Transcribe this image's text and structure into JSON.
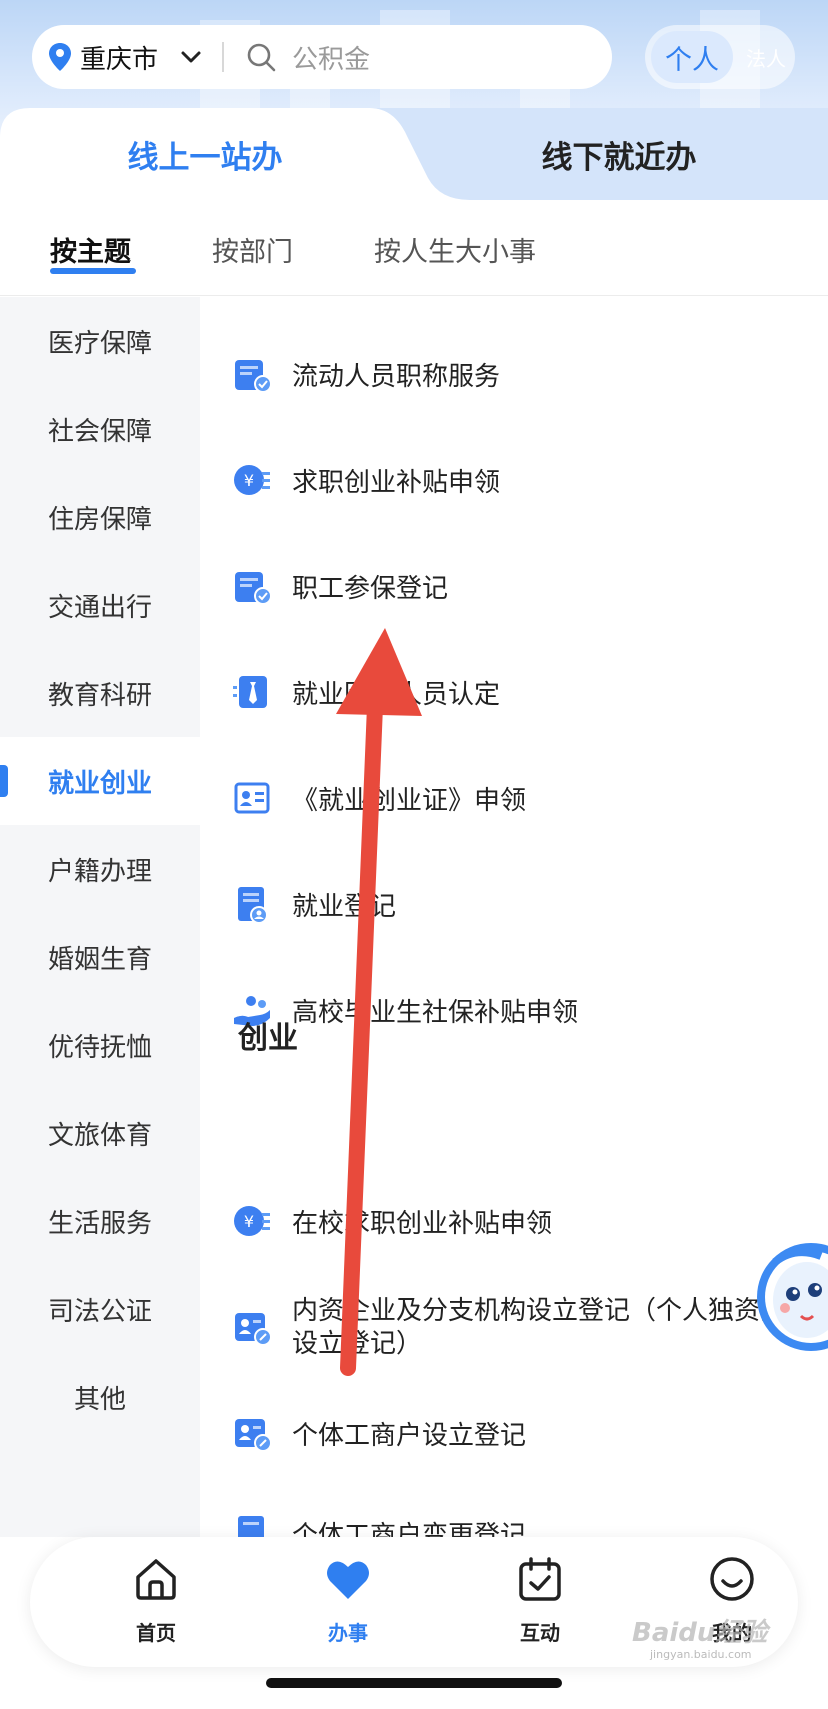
{
  "header": {
    "city": "重庆市",
    "search_placeholder": "公积金",
    "role_active": "个人",
    "role_other": "法人"
  },
  "mode_tabs": {
    "online": "线上一站办",
    "offline": "线下就近办"
  },
  "sub_tabs": [
    "按主题",
    "按部门",
    "按人生大小事"
  ],
  "sidebar": {
    "items": [
      "医疗保障",
      "社会保障",
      "住房保障",
      "交通出行",
      "教育科研",
      "就业创业",
      "户籍办理",
      "婚姻生育",
      "优待抚恤",
      "文旅体育",
      "生活服务",
      "司法公证",
      "其他"
    ],
    "active": "就业创业"
  },
  "services": [
    {
      "label": "流动人员职称服务",
      "icon": "briefcase-check-icon"
    },
    {
      "label": "求职创业补贴申领",
      "icon": "yuan-coin-icon"
    },
    {
      "label": "职工参保登记",
      "icon": "briefcase-check-icon"
    },
    {
      "label": "就业困难人员认定",
      "icon": "tie-card-icon"
    },
    {
      "label": "《就业创业证》申领",
      "icon": "id-card-icon"
    },
    {
      "label": "就业登记",
      "icon": "document-user-icon"
    },
    {
      "label": "高校毕业生社保补贴申领",
      "icon": "hand-people-icon"
    }
  ],
  "section_startup": {
    "title": "创业",
    "items": [
      {
        "label": "在校求职创业补贴申领",
        "icon": "yuan-coin-icon"
      },
      {
        "label": "内资企业及分支机构设立登记（个人独资企业设立登记）",
        "icon": "user-edit-card-icon"
      },
      {
        "label": "个体工商户设立登记",
        "icon": "user-edit-card-icon"
      },
      {
        "label": "个体工商户变更登记",
        "icon": "document-icon"
      }
    ]
  },
  "bottom_nav": [
    {
      "label": "首页",
      "icon": "home-icon"
    },
    {
      "label": "办事",
      "icon": "heart-icon",
      "active": true
    },
    {
      "label": "互动",
      "icon": "calendar-check-icon"
    },
    {
      "label": "我的",
      "icon": "smile-icon"
    }
  ],
  "watermark": {
    "text": "Baidu经验",
    "url": "jingyan.baidu.com"
  },
  "colors": {
    "accent": "#2f7ff0",
    "sidebar_bg": "#f5f6f8",
    "annotation_arrow": "#e84a3c"
  }
}
